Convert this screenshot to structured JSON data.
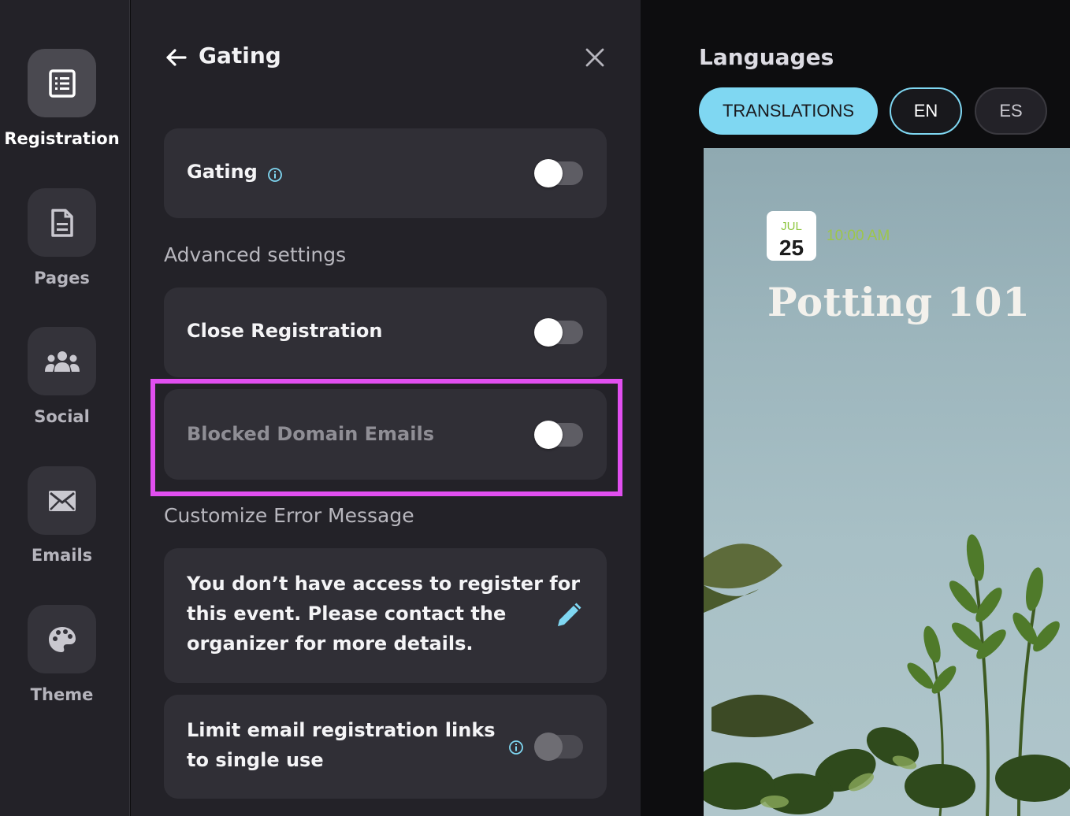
{
  "nav": {
    "items": [
      {
        "label": "Registration",
        "icon": "registration-list-icon",
        "active": true
      },
      {
        "label": "Pages",
        "icon": "page-icon",
        "active": false
      },
      {
        "label": "Social",
        "icon": "people-icon",
        "active": false
      },
      {
        "label": "Emails",
        "icon": "envelope-icon",
        "active": false
      },
      {
        "label": "Theme",
        "icon": "palette-icon",
        "active": false
      }
    ]
  },
  "panel": {
    "title": "Gating",
    "gating_card": {
      "label": "Gating",
      "enabled": false
    },
    "advanced_heading": "Advanced settings",
    "close_registration": {
      "label": "Close Registration",
      "enabled": false
    },
    "blocked_domain": {
      "label": "Blocked Domain Emails",
      "enabled": false
    },
    "error_heading": "Customize Error Message",
    "error_message": "You don’t have access to register for this event. Please contact the organizer for more details.",
    "error_message_lines": [
      "You don’t have access to register for",
      "this event. Please contact the",
      "organizer for more details."
    ],
    "limit_links": {
      "label_lines": [
        "Limit email registration links",
        "to single use"
      ],
      "enabled": false
    }
  },
  "preview": {
    "languages_title": "Languages",
    "pills": {
      "translations": "TRANSLATIONS",
      "en": "EN",
      "es": "ES"
    },
    "event": {
      "month": "JUL",
      "day": "25",
      "time": "10:00 AM",
      "title": "Potting 101"
    }
  },
  "colors": {
    "accent": "#7fd7f2",
    "highlight": "#e14ff0",
    "panel_bg": "#232228",
    "card_bg": "#302f36",
    "date_green": "#8ec63f"
  }
}
